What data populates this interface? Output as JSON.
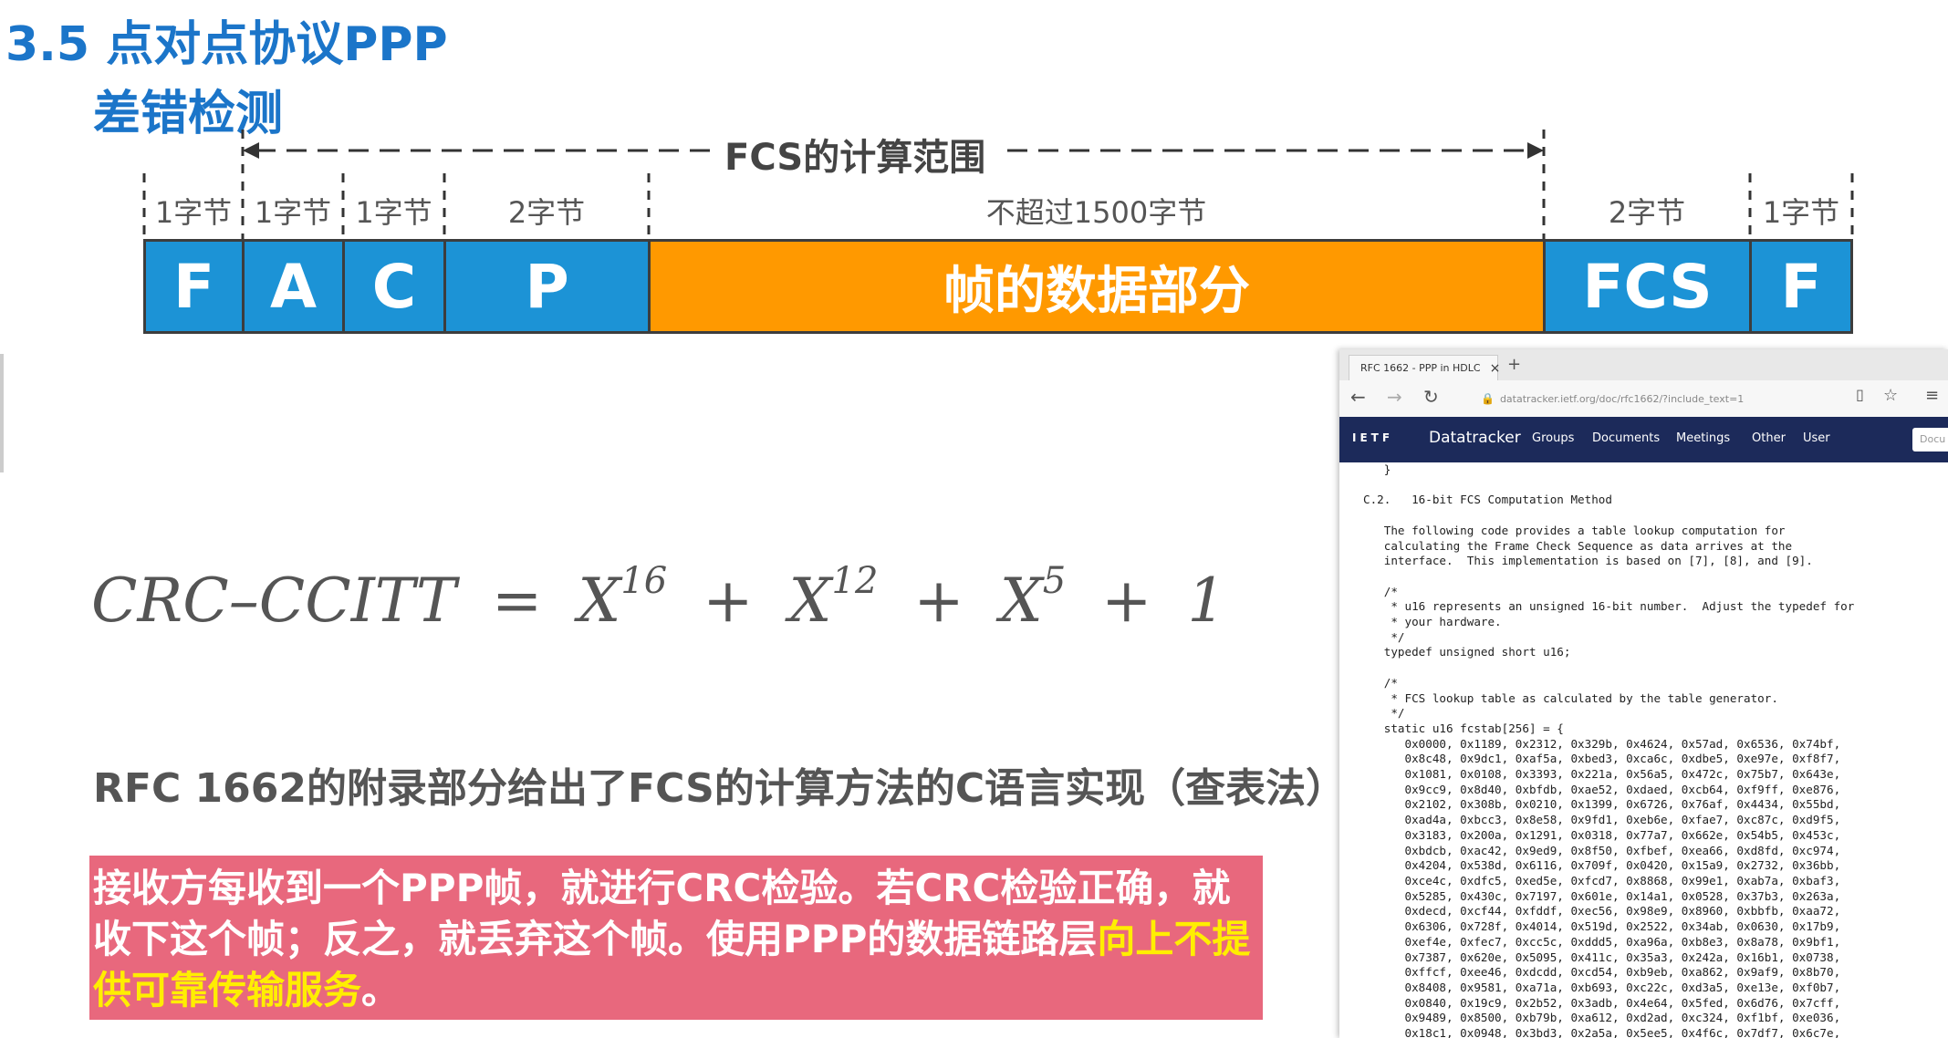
{
  "slide": {
    "title": "3.5 点对点协议PPP",
    "subtitle": "差错检测",
    "fcs_range_label": "FCS的计算范围",
    "frame_fields": [
      {
        "size": "1字节",
        "name": "F",
        "color": "#1c93d6"
      },
      {
        "size": "1字节",
        "name": "A",
        "color": "#1c93d6"
      },
      {
        "size": "1字节",
        "name": "C",
        "color": "#1c93d6"
      },
      {
        "size": "2字节",
        "name": "P",
        "color": "#1c93d6"
      },
      {
        "size": "不超过1500字节",
        "name": "帧的数据部分",
        "color": "#ff9900"
      },
      {
        "size": "2字节",
        "name": "FCS",
        "color": "#1c93d6"
      },
      {
        "size": "1字节",
        "name": "F",
        "color": "#1c93d6"
      }
    ],
    "formula": {
      "lhs": "CRC–CCITT",
      "eq": "=",
      "t1": "X",
      "e1": "16",
      "t2": "X",
      "e2": "12",
      "t3": "X",
      "e3": "5",
      "plus": "+",
      "const": "1"
    },
    "rfc_note": "RFC 1662的附录部分给出了FCS的计算方法的C语言实现（查表法）",
    "receive_note_main": "接收方每收到一个PPP帧，就进行CRC检验。若CRC检验正确，就收下这个帧；反之，就丢弃这个帧。使用PPP的数据链路层",
    "receive_note_highlight": "向上不提供可靠传输服务",
    "receive_note_end": "。"
  },
  "browser": {
    "tab_title": "RFC 1662 - PPP in HDLC",
    "tab_close": "×",
    "new_tab": "+",
    "url": "datatracker.ietf.org/doc/rfc1662/?include_text=1",
    "nav": {
      "logo": "IETF",
      "brand": "Datatracker",
      "items": [
        "Groups",
        "Documents",
        "Meetings",
        "Other",
        "User"
      ],
      "search_placeholder": "Docu"
    },
    "rfc_text": [
      "   }",
      "",
      "C.2.   16-bit FCS Computation Method",
      "",
      "   The following code provides a table lookup computation for",
      "   calculating the Frame Check Sequence as data arrives at the",
      "   interface.  This implementation is based on [7], [8], and [9].",
      "",
      "   /*",
      "    * u16 represents an unsigned 16-bit number.  Adjust the typedef for",
      "    * your hardware.",
      "    */",
      "   typedef unsigned short u16;",
      "",
      "   /*",
      "    * FCS lookup table as calculated by the table generator.",
      "    */",
      "   static u16 fcstab[256] = {",
      "      0x0000, 0x1189, 0x2312, 0x329b, 0x4624, 0x57ad, 0x6536, 0x74bf,",
      "      0x8c48, 0x9dc1, 0xaf5a, 0xbed3, 0xca6c, 0xdbe5, 0xe97e, 0xf8f7,",
      "      0x1081, 0x0108, 0x3393, 0x221a, 0x56a5, 0x472c, 0x75b7, 0x643e,",
      "      0x9cc9, 0x8d40, 0xbfdb, 0xae52, 0xdaed, 0xcb64, 0xf9ff, 0xe876,",
      "      0x2102, 0x308b, 0x0210, 0x1399, 0x6726, 0x76af, 0x4434, 0x55bd,",
      "      0xad4a, 0xbcc3, 0x8e58, 0x9fd1, 0xeb6e, 0xfae7, 0xc87c, 0xd9f5,",
      "      0x3183, 0x200a, 0x1291, 0x0318, 0x77a7, 0x662e, 0x54b5, 0x453c,",
      "      0xbdcb, 0xac42, 0x9ed9, 0x8f50, 0xfbef, 0xea66, 0xd8fd, 0xc974,",
      "      0x4204, 0x538d, 0x6116, 0x709f, 0x0420, 0x15a9, 0x2732, 0x36bb,",
      "      0xce4c, 0xdfc5, 0xed5e, 0xfcd7, 0x8868, 0x99e1, 0xab7a, 0xbaf3,",
      "      0x5285, 0x430c, 0x7197, 0x601e, 0x14a1, 0x0528, 0x37b3, 0x263a,",
      "      0xdecd, 0xcf44, 0xfddf, 0xec56, 0x98e9, 0x8960, 0xbbfb, 0xaa72,",
      "      0x6306, 0x728f, 0x4014, 0x519d, 0x2522, 0x34ab, 0x0630, 0x17b9,",
      "      0xef4e, 0xfec7, 0xcc5c, 0xddd5, 0xa96a, 0xb8e3, 0x8a78, 0x9bf1,",
      "      0x7387, 0x620e, 0x5095, 0x411c, 0x35a3, 0x242a, 0x16b1, 0x0738,",
      "      0xffcf, 0xee46, 0xdcdd, 0xcd54, 0xb9eb, 0xa862, 0x9af9, 0x8b70,",
      "      0x8408, 0x9581, 0xa71a, 0xb693, 0xc22c, 0xd3a5, 0xe13e, 0xf0b7,",
      "      0x0840, 0x19c9, 0x2b52, 0x3adb, 0x4e64, 0x5fed, 0x6d76, 0x7cff,",
      "      0x9489, 0x8500, 0xb79b, 0xa612, 0xd2ad, 0xc324, 0xf1bf, 0xe036,",
      "      0x18c1, 0x0948, 0x3bd3, 0x2a5a, 0x5ee5, 0x4f6c, 0x7df7, 0x6c7e,"
    ]
  }
}
